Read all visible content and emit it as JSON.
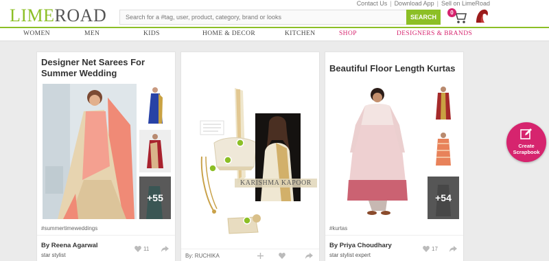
{
  "header": {
    "logo_lime": "LIME",
    "logo_road": "ROAD",
    "links": [
      "Contact Us",
      "Download App",
      "Sell on LimeRoad"
    ],
    "search_placeholder": "Search for a #tag, user, product, category, brand or looks",
    "search_button": "SEARCH",
    "cart_count": "0"
  },
  "nav": [
    "WOMEN",
    "MEN",
    "KIDS",
    "HOME & DECOR",
    "KITCHEN",
    "SHOP",
    "DESIGNERS & BRANDS"
  ],
  "cards": [
    {
      "title_line1": "Designer Net Sarees For",
      "title_line2": "Summer Wedding",
      "more": "+55",
      "hashtag": "#summertimeweddings",
      "author": "By Reena Agarwal",
      "subtitle": "star stylist",
      "likes": "11"
    },
    {
      "caption": "KARISHMA KAPOOR",
      "author_prefix": "By:",
      "author": "RUCHIKA"
    },
    {
      "title": "Beautiful Floor Length Kurtas",
      "more": "+54",
      "hashtag": "#kurtas",
      "author": "By Priya Choudhary",
      "subtitle": "star stylist expert",
      "likes": "17"
    }
  ],
  "fab": {
    "line1": "Create",
    "line2": "Scrapbook"
  },
  "colors": {
    "brand_green": "#8cbf26",
    "brand_pink": "#d6246e"
  }
}
